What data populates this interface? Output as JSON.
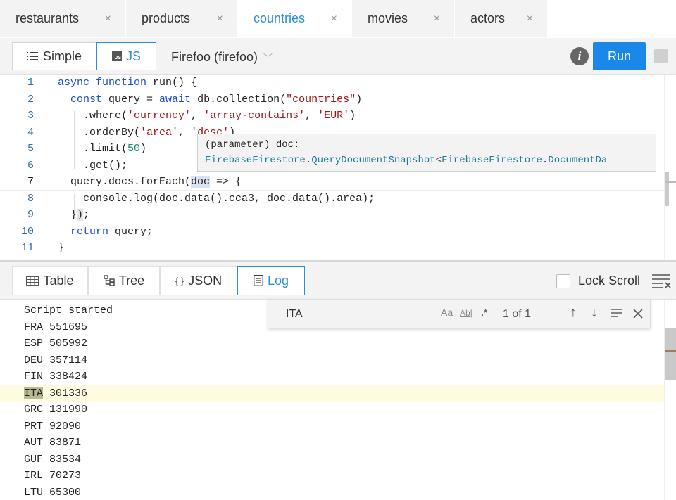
{
  "tabs": [
    {
      "label": "restaurants",
      "active": false
    },
    {
      "label": "products",
      "active": false
    },
    {
      "label": "countries",
      "active": true
    },
    {
      "label": "movies",
      "active": false
    },
    {
      "label": "actors",
      "active": false
    }
  ],
  "tab_close_glyph": "×",
  "toolbar": {
    "simple_label": "Simple",
    "js_label": "JS",
    "js_box_text": "JS",
    "database": "Firefoo (firefoo)",
    "info_glyph": "i",
    "run_label": "Run"
  },
  "editor": {
    "line_numbers": [
      "1",
      "2",
      "3",
      "4",
      "5",
      "6",
      "7",
      "8",
      "9",
      "10",
      "11"
    ],
    "current_line": 7,
    "tooltip": {
      "line1": "(parameter) doc:",
      "line2_a": "FirebaseFirestore",
      "line2_b": "QueryDocumentSnapshot",
      "line2_c": "FirebaseFirestore",
      "line2_d": "DocumentDa"
    }
  },
  "results": {
    "tabs": [
      {
        "label": "Table",
        "icon": "table-icon"
      },
      {
        "label": "Tree",
        "icon": "tree-icon"
      },
      {
        "label": "JSON",
        "icon": "braces-icon"
      },
      {
        "label": "Log",
        "icon": "log-icon"
      }
    ],
    "active_tab": "Log",
    "lock_scroll_label": "Lock Scroll"
  },
  "log": {
    "lines": [
      "Script started",
      "FRA 551695",
      "ESP 505992",
      "DEU 357114",
      "FIN 338424",
      "ITA 301336",
      "GRC 131990",
      "PRT 92090",
      "AUT 83871",
      "GUF 83534",
      "IRL 70273",
      "LTU 65300"
    ],
    "highlighted_index": 5
  },
  "find": {
    "query": "ITA",
    "match_case": "Aa",
    "whole_word": "Ab|",
    "regex": ".*",
    "count": "1 of 1"
  },
  "colors": {
    "accent": "#2a8ed8",
    "run": "#1a88e8",
    "keyword": "#1b4bd6",
    "string": "#a31515",
    "number": "#0a8a5a"
  }
}
